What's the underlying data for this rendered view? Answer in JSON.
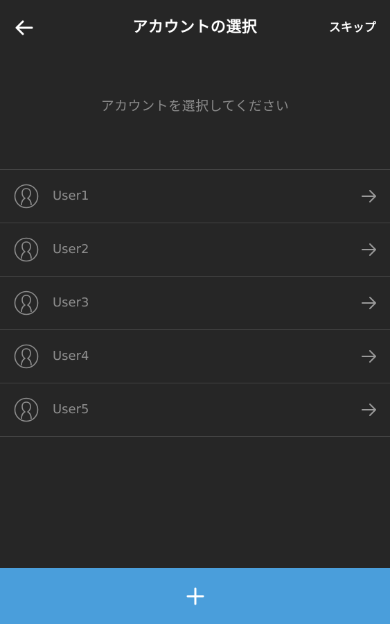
{
  "header": {
    "title": "アカウントの選択",
    "skip_label": "スキップ"
  },
  "subtitle": "アカウントを選択してください",
  "accounts": [
    {
      "name": "User1"
    },
    {
      "name": "User2"
    },
    {
      "name": "User3"
    },
    {
      "name": "User4"
    },
    {
      "name": "User5"
    }
  ],
  "icons": {
    "back": "back-arrow-icon",
    "avatar": "user-icon",
    "row_arrow": "arrow-right-icon",
    "add": "plus-icon"
  },
  "colors": {
    "background": "#262626",
    "accent": "#4a9edb",
    "divider": "#444444",
    "muted_text": "#8f8f8f"
  }
}
